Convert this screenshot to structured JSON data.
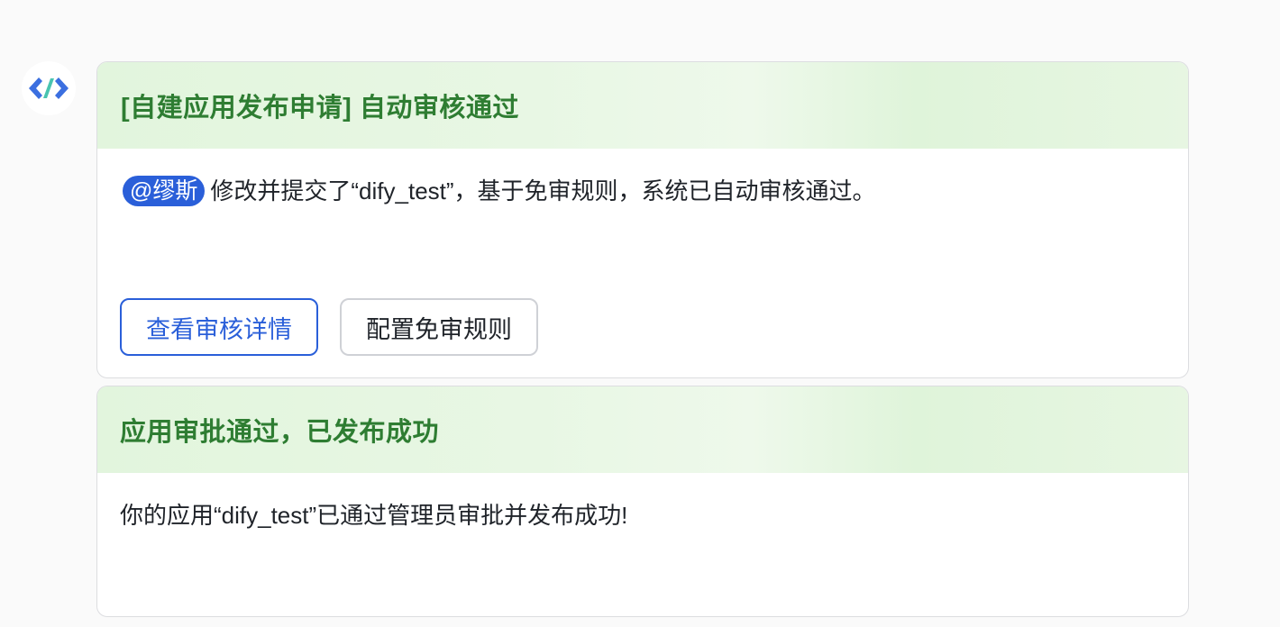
{
  "avatar": {
    "icon": "code-brackets-icon",
    "colors": [
      "#3b6fe0",
      "#49c4b0"
    ]
  },
  "card1": {
    "title": "[自建应用发布申请] 自动审核通过",
    "mention": "@缪斯",
    "message": "修改并提交了“dify_test”，基于免审规则，系统已自动审核通过。",
    "buttons": {
      "view_details": "查看审核详情",
      "configure_rules": "配置免审规则"
    }
  },
  "card2": {
    "title": "应用审批通过，已发布成功",
    "message": "你的应用“dify_test”已通过管理员审批并发布成功!"
  },
  "colors": {
    "header_green": "#e4f6df",
    "title_green": "#2e7d32",
    "accent_blue": "#2a5fd9"
  }
}
